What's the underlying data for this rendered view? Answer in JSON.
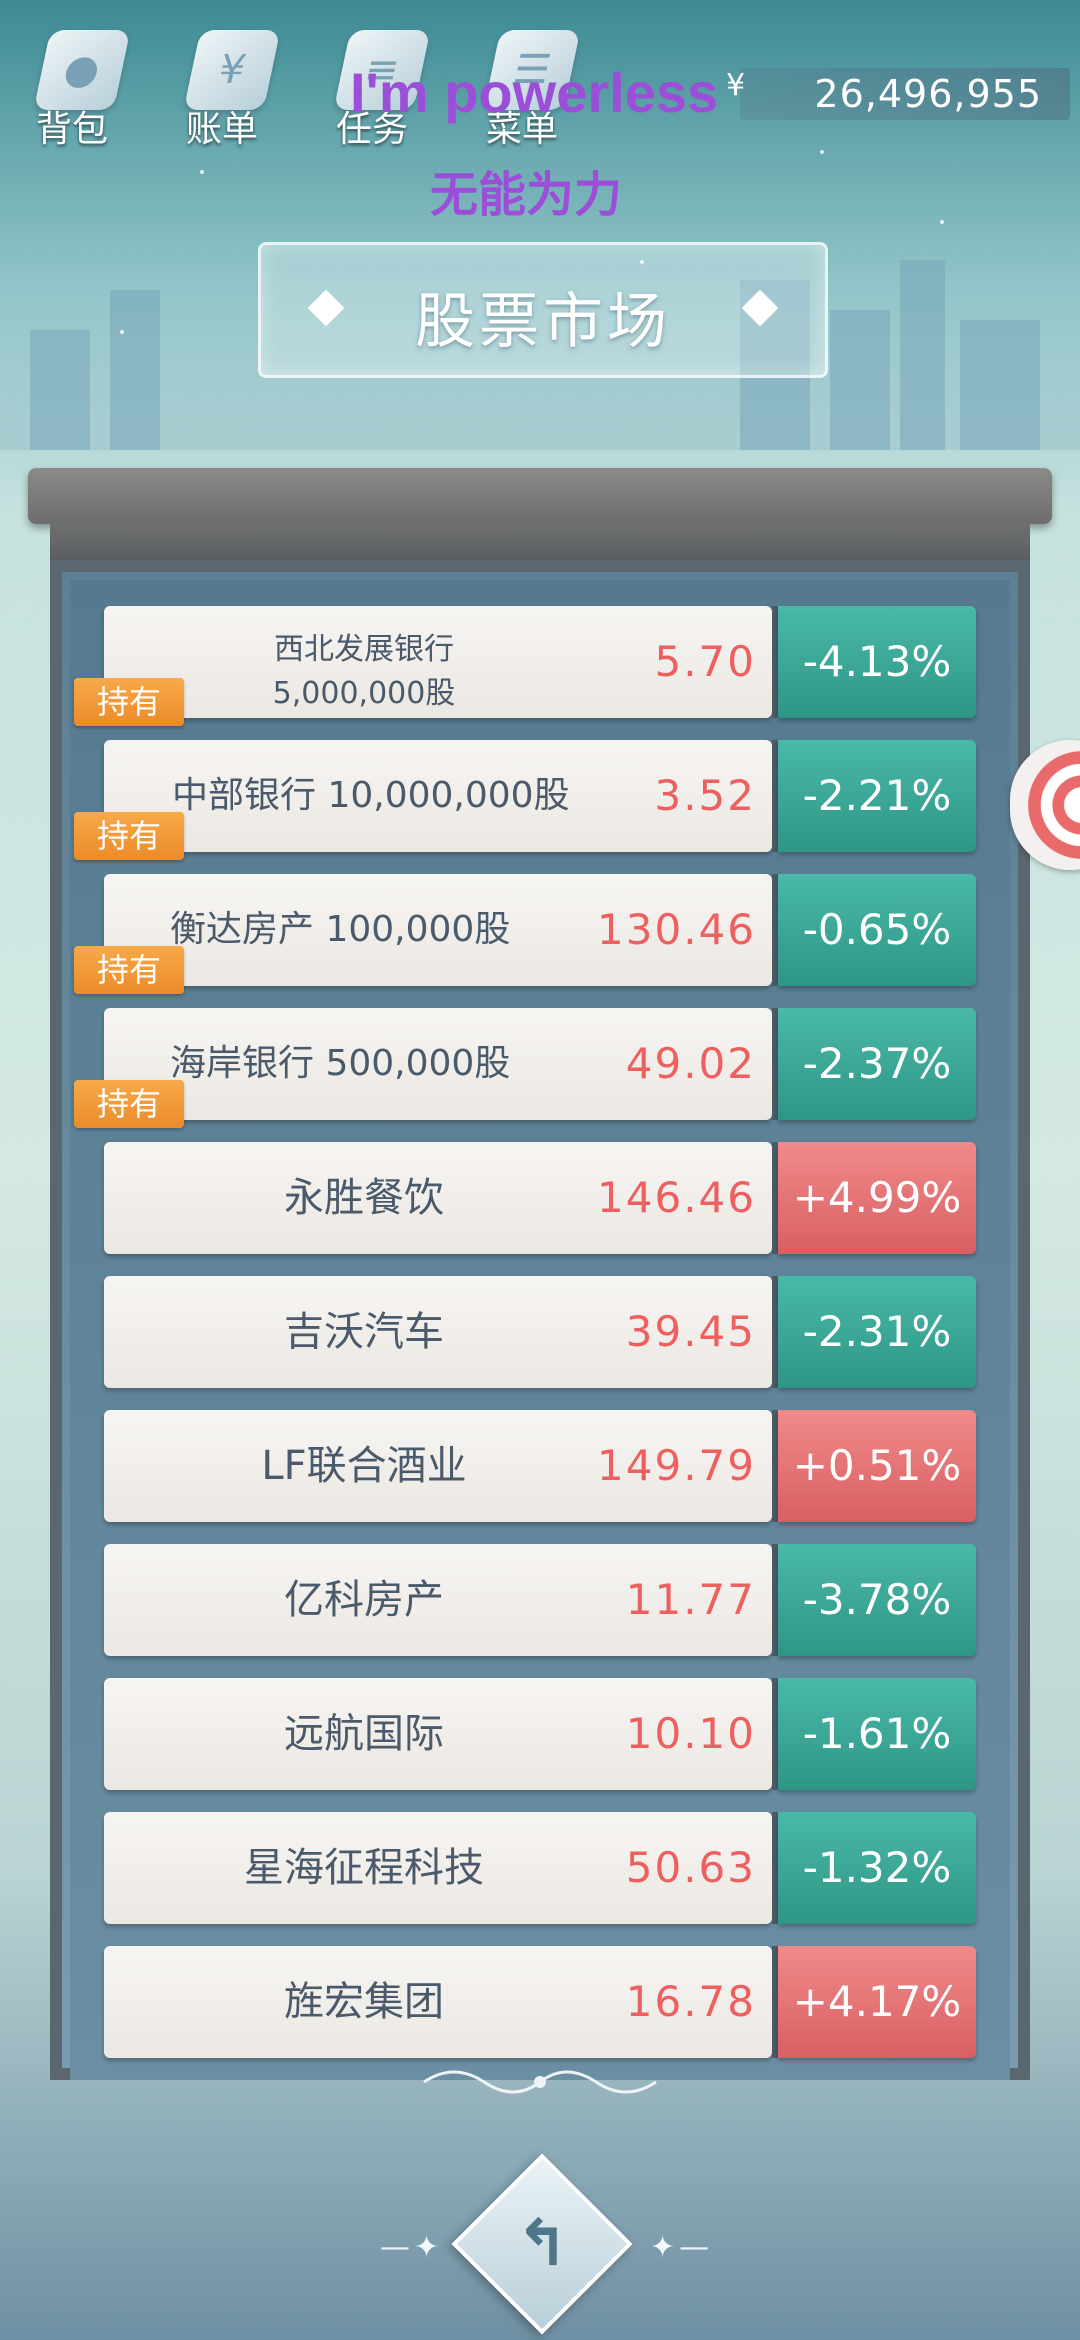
{
  "nav": [
    {
      "label": "背包",
      "icon": "backpack-icon"
    },
    {
      "label": "账单",
      "icon": "bill-icon"
    },
    {
      "label": "任务",
      "icon": "task-icon"
    },
    {
      "label": "菜单",
      "icon": "menu-icon"
    }
  ],
  "currency_symbol": "¥",
  "money": "26,496,955",
  "overlay_en": "I'm powerless",
  "overlay_cn": "无能为力",
  "title": "股票市场",
  "hold_label": "持有",
  "stocks": [
    {
      "line1": "西北发展银行",
      "line2": "5,000,000股",
      "price": "5.70",
      "change": "-4.13%",
      "dir": "down",
      "held": true,
      "layout": "two"
    },
    {
      "name": "中部银行  10,000,000股",
      "price": "3.52",
      "change": "-2.21%",
      "dir": "down",
      "held": true,
      "layout": "left"
    },
    {
      "name": "衡达房产  100,000股",
      "price": "130.46",
      "change": "-0.65%",
      "dir": "down",
      "held": true,
      "layout": "left"
    },
    {
      "name": "海岸银行  500,000股",
      "price": "49.02",
      "change": "-2.37%",
      "dir": "down",
      "held": true,
      "layout": "left"
    },
    {
      "name": "永胜餐饮",
      "price": "146.46",
      "change": "+4.99%",
      "dir": "up",
      "held": false,
      "layout": "center"
    },
    {
      "name": "吉沃汽车",
      "price": "39.45",
      "change": "-2.31%",
      "dir": "down",
      "held": false,
      "layout": "center"
    },
    {
      "name": "LF联合酒业",
      "price": "149.79",
      "change": "+0.51%",
      "dir": "up",
      "held": false,
      "layout": "center"
    },
    {
      "name": "亿科房产",
      "price": "11.77",
      "change": "-3.78%",
      "dir": "down",
      "held": false,
      "layout": "center"
    },
    {
      "name": "远航国际",
      "price": "10.10",
      "change": "-1.61%",
      "dir": "down",
      "held": false,
      "layout": "center"
    },
    {
      "name": "星海征程科技",
      "price": "50.63",
      "change": "-1.32%",
      "dir": "down",
      "held": false,
      "layout": "center"
    },
    {
      "name": "旌宏集团",
      "price": "16.78",
      "change": "+4.17%",
      "dir": "up",
      "held": false,
      "layout": "center"
    }
  ],
  "colors": {
    "down": "#2e9685",
    "up": "#d95f63",
    "price": "#ee5f5f",
    "hold": "#ec8b2a"
  }
}
